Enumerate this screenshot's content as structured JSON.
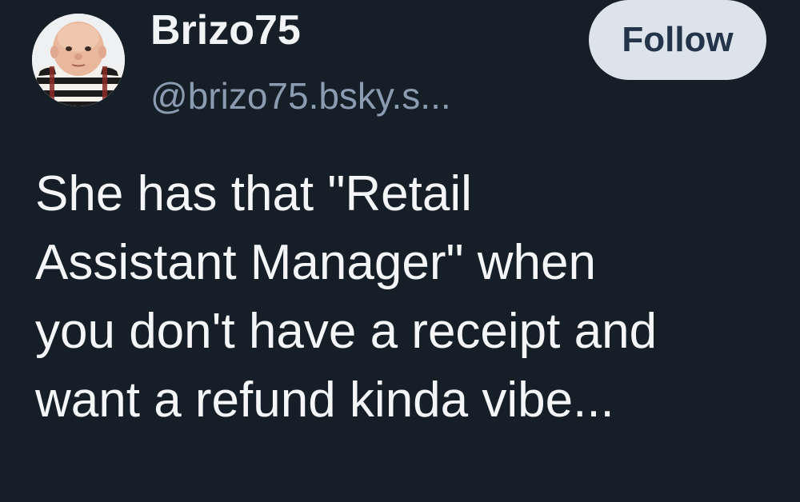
{
  "post": {
    "author": {
      "display_name": "Brizo75",
      "handle": "@brizo75.bsky.s...",
      "avatar_icon": "user-avatar"
    },
    "follow_label": "Follow",
    "text_lines": [
      "She has that \"Retail",
      "Assistant Manager\" when",
      "you don't have a receipt and",
      "want a refund kinda vibe..."
    ]
  },
  "colors": {
    "background": "#161e27",
    "text_primary": "#f1f3f5",
    "text_secondary": "#8b9bb0",
    "button_bg": "#dde3ea",
    "button_text": "#24344a"
  }
}
